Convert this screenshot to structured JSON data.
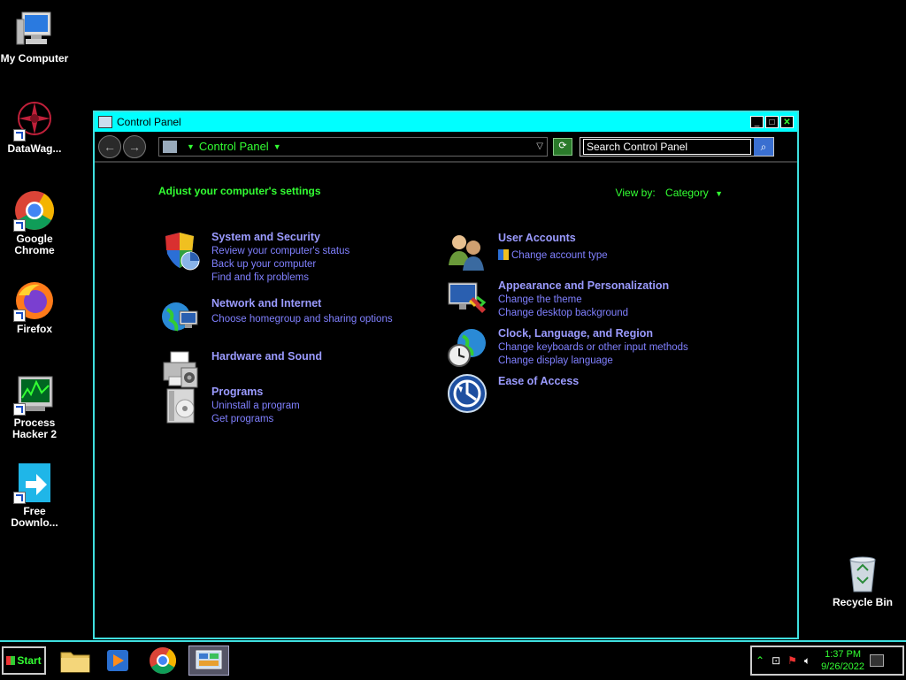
{
  "desktop": {
    "icons": [
      {
        "label": "My Computer"
      },
      {
        "label": "DataWag..."
      },
      {
        "label": "Google Chrome"
      },
      {
        "label": "Firefox"
      },
      {
        "label": "Process Hacker 2"
      },
      {
        "label": "Free Downlo..."
      },
      {
        "label": "Recycle Bin"
      }
    ]
  },
  "window": {
    "title": "Control Panel",
    "address": {
      "crumb": "Control Panel"
    },
    "search": {
      "placeholder": "Search Control Panel",
      "value": "Search Control Panel"
    },
    "heading": "Adjust your computer's settings",
    "view_by": {
      "label": "View by:",
      "value": "Category"
    },
    "categories": [
      {
        "title": "System and Security",
        "links": [
          "Review your computer's status",
          "Back up your computer",
          "Find and fix problems"
        ]
      },
      {
        "title": "Network and Internet",
        "links": [
          "Choose homegroup and sharing options"
        ]
      },
      {
        "title": "Hardware and Sound",
        "links": []
      },
      {
        "title": "Programs",
        "links": [
          "Uninstall a program",
          "Get programs"
        ]
      },
      {
        "title": "User Accounts",
        "links": [
          "Change account type"
        ]
      },
      {
        "title": "Appearance and Personalization",
        "links": [
          "Change the theme",
          "Change desktop background"
        ]
      },
      {
        "title": "Clock, Language, and Region",
        "links": [
          "Change keyboards or other input methods",
          "Change display language"
        ]
      },
      {
        "title": "Ease of Access",
        "links": []
      }
    ]
  },
  "taskbar": {
    "start_label": "Start",
    "clock": {
      "time": "1:37 PM",
      "date": "9/26/2022"
    }
  },
  "colors": {
    "accent": "#00ffff",
    "link": "#8080ff",
    "green_text": "#33ff33"
  }
}
